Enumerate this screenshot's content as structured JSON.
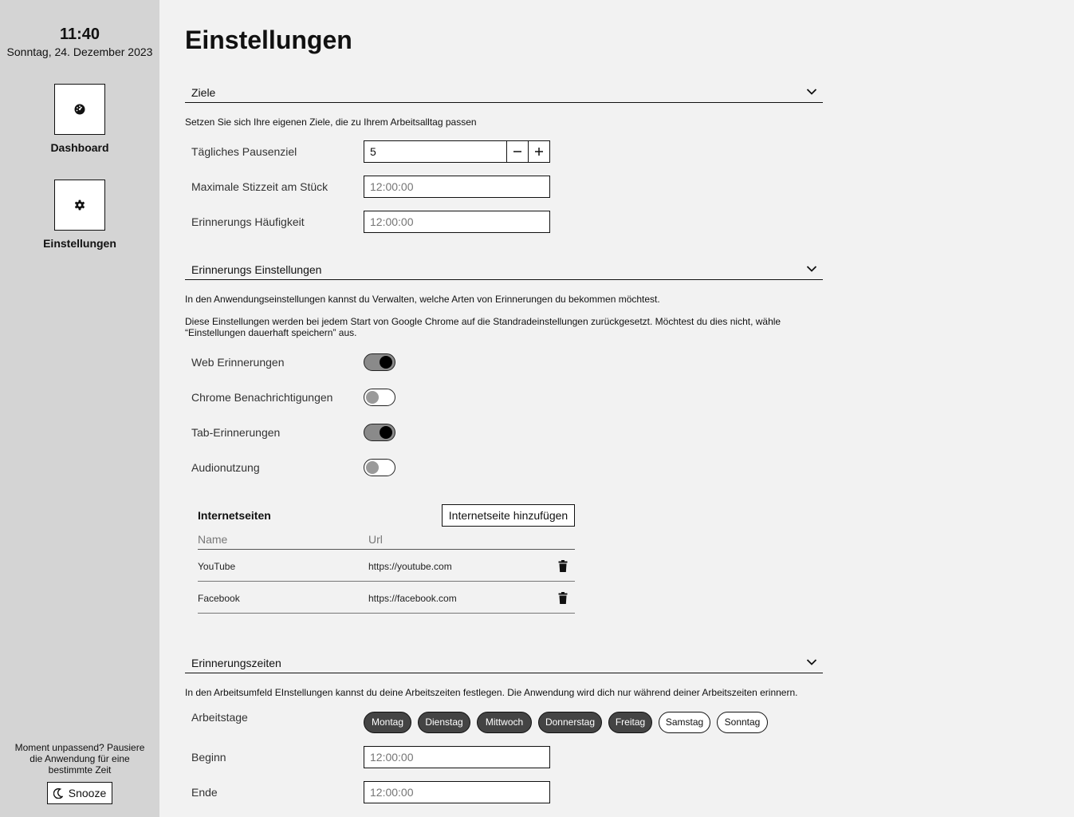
{
  "sidebar": {
    "clock": "11:40",
    "date": "Sonntag, 24. Dezember 2023",
    "nav": [
      {
        "label": "Dashboard",
        "icon": "dashboard-gauge-icon"
      },
      {
        "label": "Einstellungen",
        "icon": "gear-icon"
      }
    ],
    "snooze_prompt": "Moment unpassend? Pausiere die Anwendung für eine bestimmte Zeit",
    "snooze_label": "Snooze"
  },
  "page_title": "Einstellungen",
  "goals": {
    "header": "Ziele",
    "description": "Setzen Sie sich Ihre eigenen Ziele, die zu Ihrem Arbeitsalltag passen",
    "daily_break_goal": {
      "label": "Tägliches Pausenziel",
      "value": "5"
    },
    "max_sitting": {
      "label": "Maximale Stizzeit am Stück",
      "placeholder": "12:00:00"
    },
    "reminder_frequency": {
      "label": "Erinnerungs Häufigkeit",
      "placeholder": "12:00:00"
    }
  },
  "reminders": {
    "header": "Erinnerungs Einstellungen",
    "description1": "In den Anwendungseinstellungen kannst du Verwalten, welche Arten von Erinnerungen du bekommen möchtest.",
    "description2": "Diese Einstellungen werden bei jedem Start von Google Chrome auf die Standradeinstellungen zurückgesetzt. Möchtest du dies nicht, wähle “Einstellungen dauerhaft speichern” aus.",
    "toggles": [
      {
        "label": "Web Erinnerungen",
        "on": true
      },
      {
        "label": "Chrome Benachrichtigungen",
        "on": false
      },
      {
        "label": "Tab-Erinnerungen",
        "on": true
      },
      {
        "label": "Audionutzung",
        "on": false
      }
    ],
    "sites": {
      "title": "Internetseiten",
      "add_label": "Internetseite hinzufügen",
      "columns": [
        "Name",
        "Url"
      ],
      "rows": [
        {
          "name": "YouTube",
          "url": "https://youtube.com"
        },
        {
          "name": "Facebook",
          "url": "https://facebook.com"
        }
      ]
    }
  },
  "times": {
    "header": "Erinnerungszeiten",
    "description": "In den Arbeitsumfeld EInstellungen kannst du deine Arbeitszeiten festlegen. Die Anwendung wird dich nur während deiner Arbeitszeiten erinnern.",
    "workdays_label": "Arbeitstage",
    "days": [
      {
        "label": "Montag",
        "on": true
      },
      {
        "label": "Dienstag",
        "on": true
      },
      {
        "label": "Mittwoch",
        "on": true
      },
      {
        "label": "Donnerstag",
        "on": true
      },
      {
        "label": "Freitag",
        "on": true
      },
      {
        "label": "Samstag",
        "on": false
      },
      {
        "label": "Sonntag",
        "on": false
      }
    ],
    "start": {
      "label": "Beginn",
      "placeholder": "12:00:00"
    },
    "end": {
      "label": "Ende",
      "placeholder": "12:00:00"
    }
  }
}
